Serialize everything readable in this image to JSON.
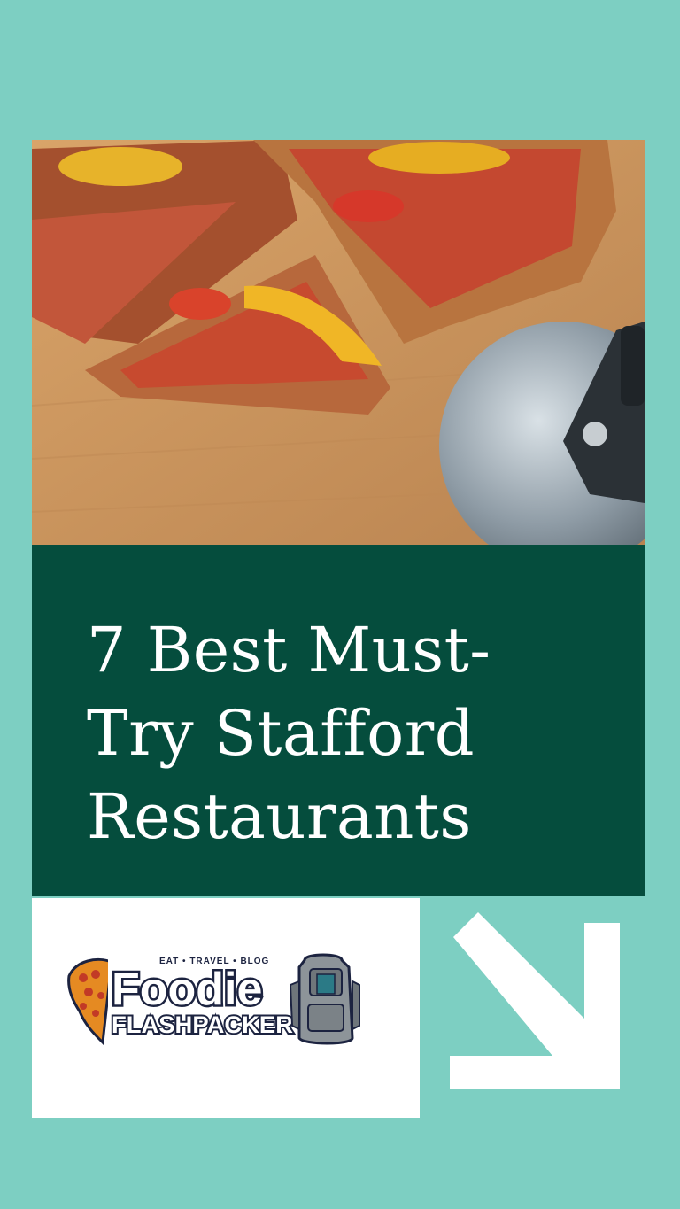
{
  "hero_image": {
    "description_icon": "pizza-photo"
  },
  "headline": {
    "line1": "7 Best Must-",
    "line2": "Try Stafford",
    "line3": "Restaurants"
  },
  "logo": {
    "tagline": "EAT • TRAVEL • BLOG",
    "name_line1": "Foodie",
    "name_line2": "FLASHPACKER",
    "icon": "backpack-pizza-logo"
  },
  "arrow": {
    "icon": "arrow-down-right-icon"
  },
  "colors": {
    "background": "#7dcfc2",
    "title_panel": "#054d3d",
    "title_text": "#ffffff",
    "logo_navy": "#1c2340"
  }
}
